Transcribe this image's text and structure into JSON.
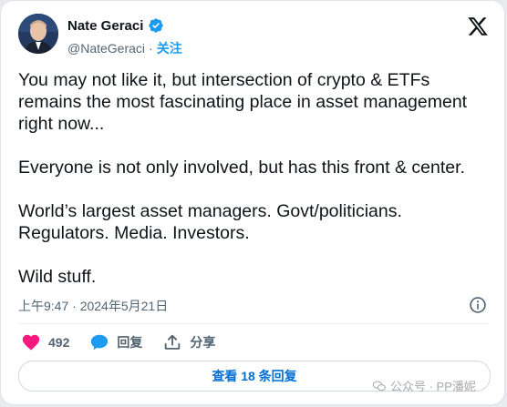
{
  "author": {
    "name": "Nate Geraci",
    "handle": "@NateGeraci",
    "separator": "·",
    "follow_label": "关注"
  },
  "tweet": {
    "paragraphs": [
      "You may not like it, but intersection of crypto & ETFs remains the most fascinating place in asset management right now...",
      "Everyone is not only involved, but has this front & center.",
      "World’s largest asset managers. Govt/politicians. Regulators. Media. Investors.",
      "Wild stuff."
    ],
    "timestamp": "上午9:47 · 2024年5月21日"
  },
  "actions": {
    "likes": "492",
    "reply_label": "回复",
    "share_label": "分享"
  },
  "replies_button": "查看 18 条回复",
  "watermark": "公众号 · PP潘妮",
  "colors": {
    "like": "#f91880",
    "reply": "#1d9bf0",
    "link": "#006fd6",
    "text": "#0f1419",
    "muted": "#536471"
  },
  "icons": {
    "verified": "verified-badge-icon",
    "x_logo": "x-logo-icon",
    "info": "info-icon",
    "like": "heart-icon",
    "reply": "speech-bubble-icon",
    "share": "share-upload-icon"
  }
}
